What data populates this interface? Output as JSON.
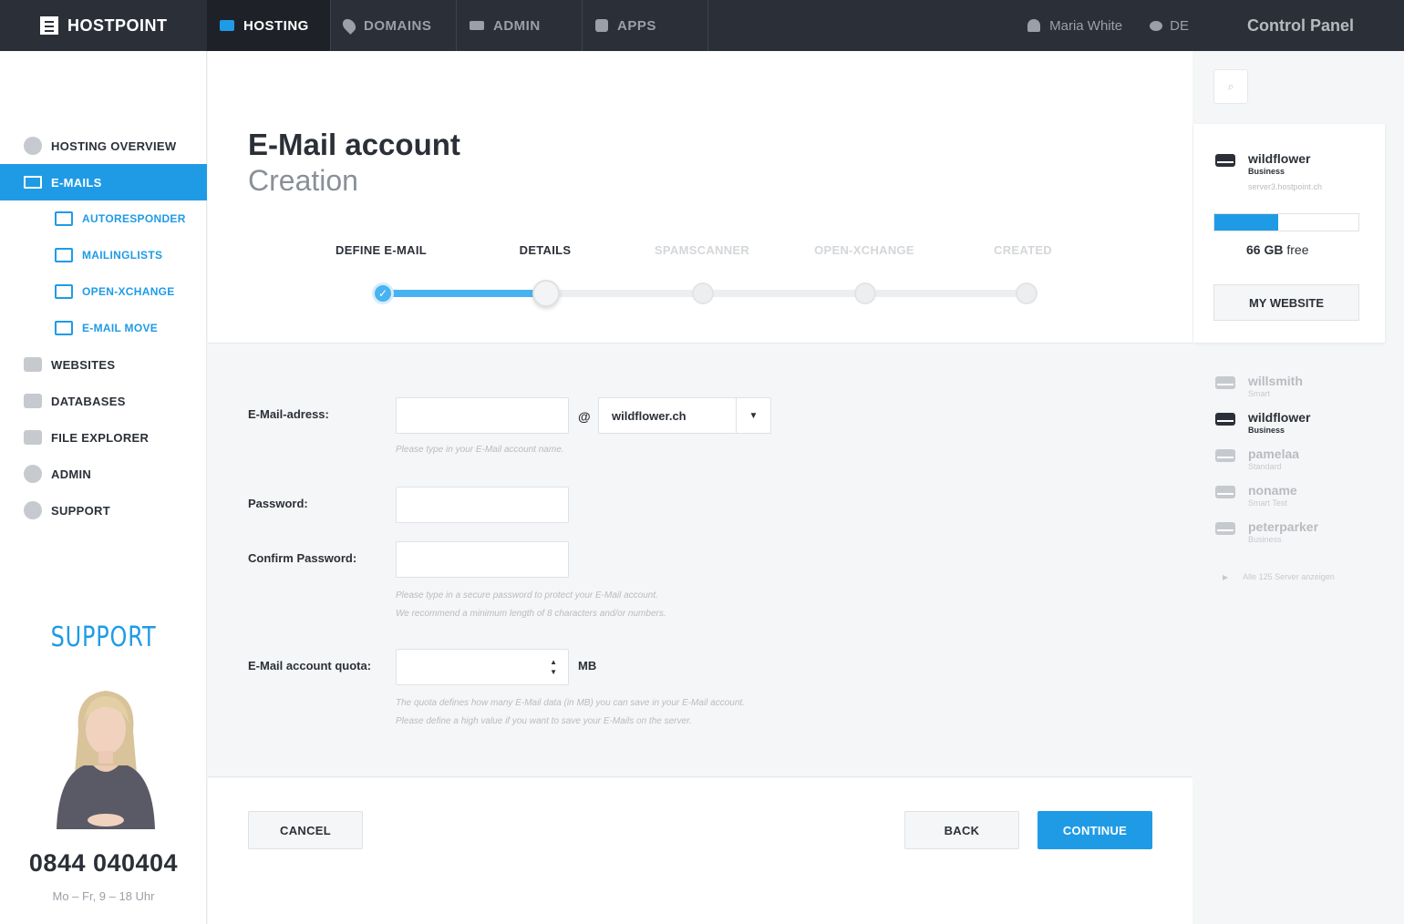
{
  "brand": {
    "name": "HOSTPOINT"
  },
  "nav": [
    {
      "label": "HOSTING",
      "icon": "hosting-icon",
      "active": true
    },
    {
      "label": "DOMAINS",
      "icon": "pin-icon"
    },
    {
      "label": "ADMIN",
      "icon": "admin-icon"
    },
    {
      "label": "APPS",
      "icon": "apps-icon"
    }
  ],
  "user": {
    "name": "Maria White",
    "lang": "DE",
    "panel_title": "Control Panel"
  },
  "sidebar": {
    "items": [
      {
        "label": "HOSTING OVERVIEW",
        "icon": "info-icon"
      },
      {
        "label": "E-MAILS",
        "icon": "envelope-icon",
        "active": true
      },
      {
        "label": "AUTORESPONDER",
        "icon": "autoresponder-icon",
        "sub": true
      },
      {
        "label": "MAILINGLISTS",
        "icon": "mailinglist-icon",
        "sub": true
      },
      {
        "label": "OPEN-XCHANGE",
        "icon": "cloud-icon",
        "sub": true
      },
      {
        "label": "E-MAIL MOVE",
        "icon": "mail-move-icon",
        "sub": true
      },
      {
        "label": "WEBSITES",
        "icon": "website-icon"
      },
      {
        "label": "DATABASES",
        "icon": "database-icon"
      },
      {
        "label": "FILE EXPLORER",
        "icon": "folder-icon"
      },
      {
        "label": "ADMIN",
        "icon": "gear-icon"
      },
      {
        "label": "SUPPORT",
        "icon": "chat-icon"
      }
    ],
    "support_title": "SUPPORT",
    "phone": "0844 040404",
    "hours": "Mo – Fr, 9 – 18 Uhr"
  },
  "page": {
    "title": "E-Mail account",
    "subtitle": "Creation"
  },
  "steps": [
    {
      "label": "DEFINE E-MAIL",
      "state": "done"
    },
    {
      "label": "DETAILS",
      "state": "current"
    },
    {
      "label": "SPAMSCANNER",
      "state": "pending"
    },
    {
      "label": "OPEN-XCHANGE",
      "state": "pending"
    },
    {
      "label": "CREATED",
      "state": "pending"
    }
  ],
  "form": {
    "email_label": "E-Mail-adress:",
    "email_value": "",
    "at": "@",
    "domain_value": "wildflower.ch",
    "email_hint": "Please type in your E-Mail account name.",
    "password_label": "Password:",
    "confirm_label": "Confirm Password:",
    "password_hint_1": "Please type in a secure password to protect your E-Mail account.",
    "password_hint_2": "We recommend a minimum length of 8 characters and/or numbers.",
    "quota_label": "E-Mail account quota:",
    "quota_unit": "MB",
    "quota_hint_1": "The quota defines how many E-Mail data (in MB) you can save in your E-Mail account.",
    "quota_hint_2": "Please define a high value if you want to save your E-Mails on the server."
  },
  "buttons": {
    "cancel": "CANCEL",
    "back": "BACK",
    "continue": "CONTINUE"
  },
  "right": {
    "current": {
      "name": "wildflower",
      "plan": "Business",
      "host": "server3.hostpoint.ch"
    },
    "usage_fraction": 0.44,
    "free_amount": "66 GB",
    "free_unit": "free",
    "my_website": "MY WEBSITE",
    "servers": [
      {
        "name": "willsmith",
        "plan": "Smart"
      },
      {
        "name": "wildflower",
        "plan": "Business",
        "selected": true
      },
      {
        "name": "pamelaa",
        "plan": "Standard"
      },
      {
        "name": "noname",
        "plan": "Smart Test"
      },
      {
        "name": "peterparker",
        "plan": "Business"
      }
    ],
    "show_all": "Alle 125 Server anzeigen"
  },
  "colors": {
    "accent": "#1f9be6",
    "topbar": "#2b3038"
  }
}
